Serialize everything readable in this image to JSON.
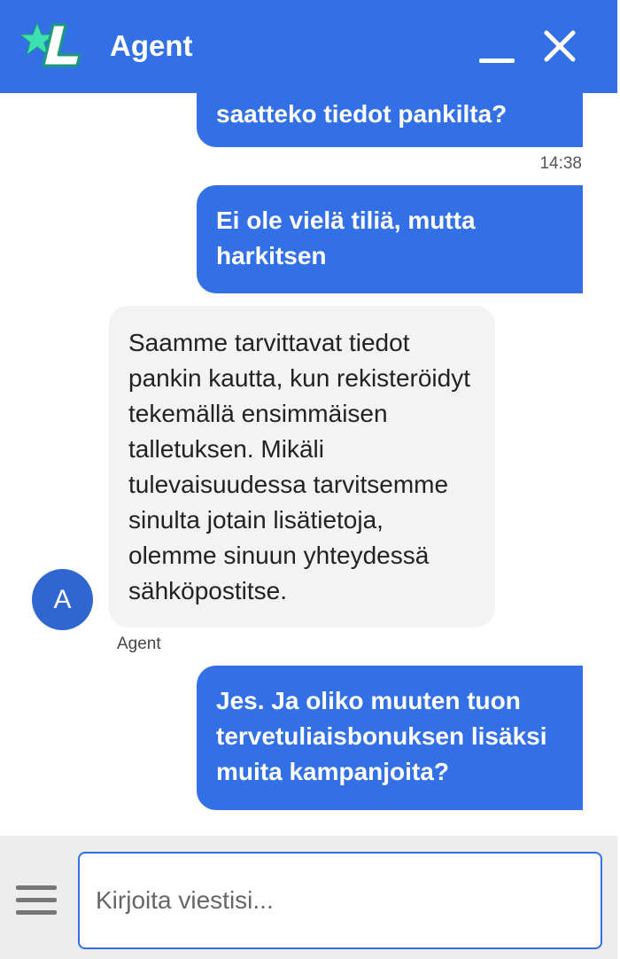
{
  "header": {
    "title": "Agent",
    "brand_color": "#3370e6",
    "logo_icon": "star-l-logo-icon",
    "minimize_icon": "minimize-icon",
    "close_icon": "close-icon"
  },
  "messages": [
    {
      "sender": "user",
      "text": "saatteko tiedot pankilta?",
      "time": "14:38"
    },
    {
      "sender": "user",
      "text": "Ei ole vielä tiliä, mutta harkitsen"
    },
    {
      "sender": "agent",
      "text": "Saamme tarvittavat tiedot pankin kautta, kun rekisteröidyt tekemällä ensimmäisen talletuksen. Mikäli tulevaisuudessa tarvitsemme sinulta jotain lisätietoja, olemme sinuun yhteydessä sähköpostitse.",
      "avatar_initial": "A",
      "sender_name": "Agent"
    },
    {
      "sender": "user",
      "text": "Jes. Ja oliko muuten tuon tervetuliaisbonuksen lisäksi muita kampanjoita?"
    }
  ],
  "composer": {
    "placeholder": "Kirjoita viestisi...",
    "value": "",
    "menu_icon": "hamburger-menu-icon"
  }
}
